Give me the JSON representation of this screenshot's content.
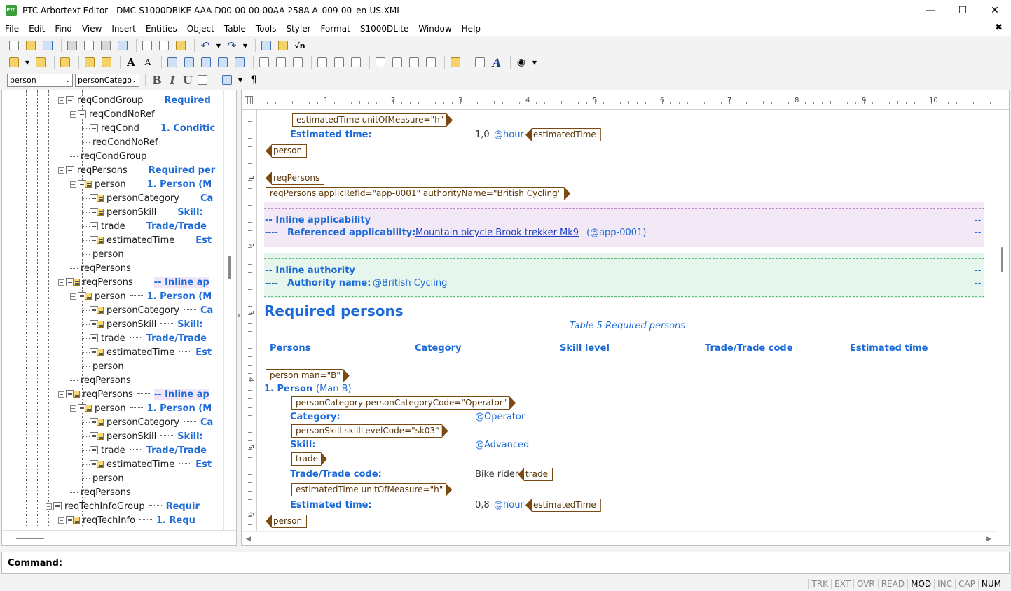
{
  "window": {
    "title": "PTC Arbortext Editor - DMC-S1000DBIKE-AAA-D00-00-00-00AA-258A-A_009-00_en-US.XML",
    "app_icon": "PTC"
  },
  "menu": [
    "File",
    "Edit",
    "Find",
    "View",
    "Insert",
    "Entities",
    "Object",
    "Table",
    "Tools",
    "Styler",
    "Format",
    "S1000DLite",
    "Window",
    "Help"
  ],
  "format_bar": {
    "element_combo": "person",
    "style_combo": "personCatego",
    "bold": "B",
    "italic": "I",
    "underline": "U",
    "pilcrow": "¶"
  },
  "tree": [
    {
      "indent": 2,
      "name": "reqCondGroup",
      "val": "Required",
      "toggle": "−",
      "icon": "list"
    },
    {
      "indent": 3,
      "name": "reqCondNoRef",
      "val": "",
      "toggle": "−",
      "icon": "list"
    },
    {
      "indent": 4,
      "name": "reqCond",
      "val": "1. Conditic",
      "toggle": "",
      "icon": "list"
    },
    {
      "indent": 4,
      "name": "reqCondNoRef",
      "val": "",
      "toggle": "",
      "icon": "none"
    },
    {
      "indent": 3,
      "name": "reqCondGroup",
      "val": "",
      "toggle": "",
      "icon": "none"
    },
    {
      "indent": 2,
      "name": "reqPersons",
      "val": "Required per",
      "toggle": "−",
      "icon": "list"
    },
    {
      "indent": 3,
      "name": "person",
      "val": "1. Person (M",
      "toggle": "−",
      "icon": "yellow"
    },
    {
      "indent": 4,
      "name": "personCategory",
      "val": "Ca",
      "toggle": "",
      "icon": "yellow"
    },
    {
      "indent": 4,
      "name": "personSkill",
      "val": "Skill:",
      "toggle": "",
      "icon": "yellow"
    },
    {
      "indent": 4,
      "name": "trade",
      "val": "Trade/Trade",
      "toggle": "",
      "icon": "list"
    },
    {
      "indent": 4,
      "name": "estimatedTime",
      "val": "Est",
      "toggle": "",
      "icon": "yellow"
    },
    {
      "indent": 4,
      "name": "person",
      "val": "",
      "toggle": "",
      "icon": "none"
    },
    {
      "indent": 3,
      "name": "reqPersons",
      "val": "",
      "toggle": "",
      "icon": "none"
    },
    {
      "indent": 2,
      "name": "reqPersons",
      "val": "-- Inline ap",
      "toggle": "−",
      "icon": "yellow",
      "pink": true
    },
    {
      "indent": 3,
      "name": "person",
      "val": "1. Person (M",
      "toggle": "−",
      "icon": "yellow"
    },
    {
      "indent": 4,
      "name": "personCategory",
      "val": "Ca",
      "toggle": "",
      "icon": "yellow"
    },
    {
      "indent": 4,
      "name": "personSkill",
      "val": "Skill:",
      "toggle": "",
      "icon": "yellow"
    },
    {
      "indent": 4,
      "name": "trade",
      "val": "Trade/Trade",
      "toggle": "",
      "icon": "list"
    },
    {
      "indent": 4,
      "name": "estimatedTime",
      "val": "Est",
      "toggle": "",
      "icon": "yellow"
    },
    {
      "indent": 4,
      "name": "person",
      "val": "",
      "toggle": "",
      "icon": "none"
    },
    {
      "indent": 3,
      "name": "reqPersons",
      "val": "",
      "toggle": "",
      "icon": "none"
    },
    {
      "indent": 2,
      "name": "reqPersons",
      "val": "-- Inline ap",
      "toggle": "−",
      "icon": "yellow",
      "pink": true
    },
    {
      "indent": 3,
      "name": "person",
      "val": "1. Person (M",
      "toggle": "−",
      "icon": "yellow"
    },
    {
      "indent": 4,
      "name": "personCategory",
      "val": "Ca",
      "toggle": "",
      "icon": "yellow"
    },
    {
      "indent": 4,
      "name": "personSkill",
      "val": "Skill:",
      "toggle": "",
      "icon": "yellow"
    },
    {
      "indent": 4,
      "name": "trade",
      "val": "Trade/Trade",
      "toggle": "",
      "icon": "list"
    },
    {
      "indent": 4,
      "name": "estimatedTime",
      "val": "Est",
      "toggle": "",
      "icon": "yellow"
    },
    {
      "indent": 4,
      "name": "person",
      "val": "",
      "toggle": "",
      "icon": "none"
    },
    {
      "indent": 3,
      "name": "reqPersons",
      "val": "",
      "toggle": "",
      "icon": "none"
    },
    {
      "indent": 1,
      "name": "reqTechInfoGroup",
      "val": "Requir",
      "toggle": "−",
      "icon": "list"
    },
    {
      "indent": 2,
      "name": "reqTechInfo",
      "val": "1. Requ",
      "toggle": "−",
      "icon": "yellow"
    }
  ],
  "ruler": {
    "numbers": [
      "1",
      "2",
      "3",
      "4",
      "5",
      "6",
      "7",
      "8",
      "9",
      "10"
    ],
    "vnumbers": [
      "1",
      "2",
      "3",
      "4",
      "5",
      "6"
    ]
  },
  "doc": {
    "tag_est_start1": "estimatedTime unitOfMeasure=\"h\"",
    "est_label1": "Estimated time:",
    "est_value1": "1,0",
    "est_unit1": "@hour",
    "tag_est_end1": "estimatedTime",
    "tag_person_end1": "person",
    "tag_reqpersons_end": "reqPersons",
    "tag_reqpersons_start": "reqPersons applicRefId=\"app-0001\" authorityName=\"British Cycling\"",
    "applic_title": "-- Inline applicability",
    "applic_ref_prefix": "----",
    "applic_ref_label": "Referenced applicability:",
    "applic_ref_link": "Mountain bicycle Brook trekker Mk9",
    "applic_ref_id": "(@app-0001)",
    "applic_right1": "--",
    "applic_right2": "--",
    "auth_title": "-- Inline authority",
    "auth_prefix": "----",
    "auth_label": "Authority name:",
    "auth_value": "@British Cycling",
    "auth_right1": "--",
    "auth_right2": "--",
    "heading": "Required persons",
    "caption": "Table 5  Required persons",
    "columns": [
      "Persons",
      "Category",
      "Skill level",
      "Trade/Trade code",
      "Estimated time"
    ],
    "tag_person_start": "person man=\"B\"",
    "person_label": "1. Person",
    "person_man": "(Man B)",
    "tag_cat_start": "personCategory personCategoryCode=\"Operator\"",
    "cat_label": "Category:",
    "cat_value": "@Operator",
    "tag_skill_start": "personSkill skillLevelCode=\"sk03\"",
    "skill_label": "Skill:",
    "skill_value": "@Advanced",
    "tag_trade_start": "trade",
    "trade_label": "Trade/Trade code:",
    "trade_value": "Bike rider",
    "tag_trade_end": "trade",
    "tag_est_start2": "estimatedTime unitOfMeasure=\"h\"",
    "est_label2": "Estimated time:",
    "est_value2": "0,8",
    "est_unit2": "@hour",
    "tag_est_end2": "estimatedTime",
    "tag_person_end2": "person"
  },
  "command": {
    "label": "Command:"
  },
  "status": [
    {
      "label": "TRK",
      "on": false
    },
    {
      "label": "EXT",
      "on": false
    },
    {
      "label": "OVR",
      "on": false
    },
    {
      "label": "READ",
      "on": false
    },
    {
      "label": "MOD",
      "on": true
    },
    {
      "label": "INC",
      "on": false
    },
    {
      "label": "CAP",
      "on": false
    },
    {
      "label": "NUM",
      "on": true
    }
  ],
  "colors": {
    "accent": "#1c6bd8",
    "tag": "#7b4a12",
    "pink": "#f3e9f6",
    "green": "#e6f6ec"
  }
}
